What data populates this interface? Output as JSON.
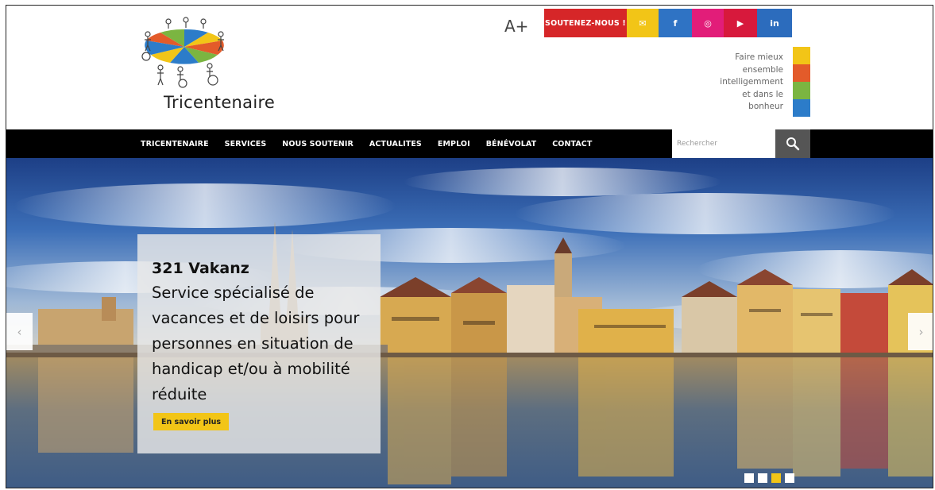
{
  "header": {
    "site_name": "Tricentenaire",
    "font_size_button": "A+",
    "support_label": "SOUTENEZ-NOUS !",
    "social": [
      {
        "name": "mail-icon",
        "label": "✉",
        "color": "#f2c517"
      },
      {
        "name": "facebook-icon",
        "label": "f",
        "color": "#2f73c4"
      },
      {
        "name": "instagram-icon",
        "label": "◎",
        "color": "#e21d79"
      },
      {
        "name": "youtube-icon",
        "label": "▶",
        "color": "#d7193c"
      },
      {
        "name": "linkedin-icon",
        "label": "in",
        "color": "#2c6cbd"
      }
    ],
    "tagline": [
      "Faire mieux",
      "ensemble",
      "intelligemment",
      "et dans le",
      "bonheur"
    ],
    "tagline_colors": [
      "#f2c517",
      "#e35b2a",
      "#7bb541",
      "#2c7cc9"
    ]
  },
  "nav": {
    "items": [
      "TRICENTENAIRE",
      "SERVICES",
      "NOUS SOUTENIR",
      "ACTUALITES",
      "EMPLOI",
      "BÉNÉVOLAT",
      "CONTACT"
    ],
    "search_placeholder": "Rechercher"
  },
  "hero": {
    "title": "321 Vakanz",
    "body": "Service spécialisé de vacances et de loisirs pour personnes en situation de handicap et/ou à mobilité réduite",
    "cta": "En savoir plus",
    "prev": "‹",
    "next": "›",
    "slides": 4,
    "active_slide": 3
  }
}
